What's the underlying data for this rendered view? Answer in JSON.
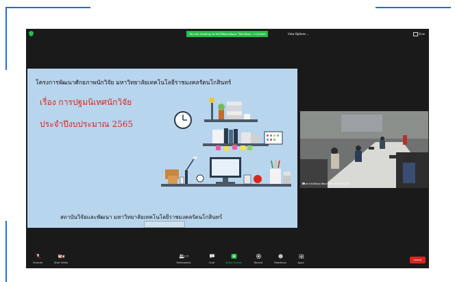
{
  "colors": {
    "accent": "#1a6fd6",
    "share_green": "#23c04a",
    "leave_red": "#d7261f",
    "slide_bg": "#b8d5ee",
    "slide_red": "#d9261c"
  },
  "topbar": {
    "banner": "You are viewing สถาบันวิจัยและพัฒนา วิทยาลัยเท...'s screen",
    "view_options": "View Options ⌄",
    "view_label": "View"
  },
  "slide": {
    "title": "โครงการพัฒนาศักยภาพนักวิจัย มหาวิทยาลัยเทคโนโลยีราชมงคลรัตนโกสินทร์",
    "subtitle_line1": "เรื่อง การปฐมนิเทศนักวิจัย",
    "subtitle_line2": "ประจำปีงบประมาณ 2565",
    "footer": "สถาบันวิจัยและพัฒนา มหาวิทยาลัยเทคโนโลยีราชมงคลรัตนโกสินทร์"
  },
  "video": {
    "participant_name": "สถาบันวิจัยและพัฒนา วิทยาลัยเทคโนโลยี"
  },
  "controls": {
    "unmute": "Unmute",
    "start_video": "Start Video",
    "participants": "Participants",
    "participant_count": "115",
    "chat": "Chat",
    "share_screen": "Share Screen",
    "record": "Record",
    "reactions": "Reactions",
    "apps": "Apps",
    "leave": "Leave"
  }
}
